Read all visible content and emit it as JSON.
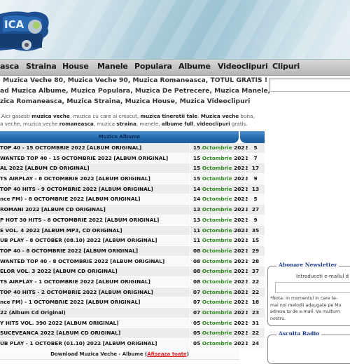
{
  "header": {
    "logo_alt": "Muzica Veche logo",
    "logo_text": "ICA"
  },
  "nav": {
    "items": [
      {
        "label": "asca"
      },
      {
        "label": "Straina"
      },
      {
        "label": "House"
      },
      {
        "label": "Manele"
      },
      {
        "label": "Populara"
      },
      {
        "label": "Albume"
      },
      {
        "label": "Videoclipuri"
      },
      {
        "label": "Clipuri"
      }
    ]
  },
  "intro": {
    "line1": "Muzica Veche 80, Muzica Veche 90, Muzica Romaneasca, TOTUL GRATIS !",
    "line2": "ad Muzica Albume, Muzica Populara, Muzica De Petrecere, Muzica Manele,",
    "line3": "zica Romaneasca, Muzica Straina, Muzica House, Muzica Videoclipuri"
  },
  "description": {
    "l1_a": "Aici gasesti ",
    "l1_b": "muzica veche",
    "l1_c": ", muzica cu care ai crescut, ",
    "l1_d": "muzica tineretii tale",
    "l1_e": ". ",
    "l1_f": "Muzica veche",
    "l1_g": " buna,",
    "l2_a": "a veche, muzica veche ",
    "l2_b": "romaneasca",
    "l2_c": ", muzica ",
    "l2_d": "straina",
    "l2_e": ", manele, ",
    "l2_f": "albume full",
    "l2_g": ", ",
    "l2_h": "videoclipuri",
    "l2_i": " gratis."
  },
  "albums_table": {
    "header": "Muzica Albume",
    "rows": [
      {
        "title": "TOP 40 - 15 OCTOMBRIE 2022 [ALBUM ORIGINAL]",
        "day": "15",
        "month": "Octombrie",
        "year": "2022",
        "count": "5"
      },
      {
        "title": "WANTED TOP 40 - 15 OCTOMBRIE 2022 [ALBUM ORIGINAL]",
        "day": "15",
        "month": "Octombrie",
        "year": "2022",
        "count": "7"
      },
      {
        "title": "AL 2022 [ALBUM CD ORIGINAL]",
        "day": "15",
        "month": "Octombrie",
        "year": "2022",
        "count": "17"
      },
      {
        "title": "TS AIRPLAY - 8 OCTOMBRIE 2022 [ALBUM ORIGINAL]",
        "day": "15",
        "month": "Octombrie",
        "year": "2022",
        "count": "9"
      },
      {
        "title": "TOP 40 HITS - 9 OCTOMBRIE 2022 [ALBUM ORIGINAL]",
        "day": "14",
        "month": "Octombrie",
        "year": "2022",
        "count": "13"
      },
      {
        "title": "nce FM) - 8 OCTOMBRIE 2022 [ALBUM ORIGINAL]",
        "day": "14",
        "month": "Octombrie",
        "year": "2022",
        "count": "5"
      },
      {
        "title": "ROMANI 2022 [ALBUM CD ORIGINAL]",
        "day": "13",
        "month": "Octombrie",
        "year": "2022",
        "count": "27"
      },
      {
        "title": "P HOT 30 HITS - 8 OCTOMBRIE 2022 [ALBUM ORIGINAL]",
        "day": "13",
        "month": "Octombrie",
        "year": "2022",
        "count": "9"
      },
      {
        "title": "E VOL. 4 2022 [ALBUM MP3, CD ORIGINAL]",
        "day": "11",
        "month": "Octombrie",
        "year": "2022",
        "count": "35"
      },
      {
        "title": "UB PLAY - 8 OCTOBER (08.10) 2022 [ALBUM ORIGINAL]",
        "day": "11",
        "month": "Octombrie",
        "year": "2022",
        "count": "15"
      },
      {
        "title": "TOP 40 - 8 OCTOMBRIE 2022 [ALBUM ORIGINAL]",
        "day": "08",
        "month": "Octombrie",
        "year": "2022",
        "count": "29"
      },
      {
        "title": "WANTED TOP 40 - 8 OCTOMBRIE 2022 [ALBUM ORIGINAL]",
        "day": "08",
        "month": "Octombrie",
        "year": "2022",
        "count": "28"
      },
      {
        "title": "ELOR VOL. 3 2022 [ALBUM CD ORIGINAL]",
        "day": "08",
        "month": "Octombrie",
        "year": "2022",
        "count": "37"
      },
      {
        "title": "TS AIRPLAY - 1 OCTOMBRIE 2022 [ALBUM ORIGINAL]",
        "day": "08",
        "month": "Octombrie",
        "year": "2022",
        "count": "22"
      },
      {
        "title": "TOP 40 HITS - 2 OCTOMBRIE 2022 [ALBUM ORIGINAL]",
        "day": "07",
        "month": "Octombrie",
        "year": "2022",
        "count": "22"
      },
      {
        "title": "nce FM) - 1 OCTOMBRIE 2022 [ALBUM ORIGINAL]",
        "day": "07",
        "month": "Octombrie",
        "year": "2022",
        "count": "18"
      },
      {
        "title": "22 (Album Cd Original)",
        "day": "07",
        "month": "Octombrie",
        "year": "2022",
        "count": "23"
      },
      {
        "title": "Y HITS VOL. 390 2022 [ALBUM ORIGINAL]",
        "day": "05",
        "month": "Octombrie",
        "year": "2022",
        "count": "31"
      },
      {
        "title": "SUCEVEANCA 2022 [ALBUM CD ORIGINAL]",
        "day": "05",
        "month": "Octombrie",
        "year": "2022",
        "count": "22"
      },
      {
        "title": "UB PLAY - 1 OCTOBER (01.10) 2022 [ALBUM ORIGINAL]",
        "day": "05",
        "month": "Octombrie",
        "year": "2022",
        "count": "24"
      }
    ],
    "footer_text": "Download Muzica Veche - Albume (",
    "footer_link": "Afiseaza toate",
    "footer_close": ")"
  },
  "sidebar": {
    "search_value": "",
    "newsletter": {
      "legend": "Abonare Newsletter",
      "label": "Introduceti e-mailul d",
      "email_value": "",
      "note_1": "*Nota: In momentul in care te-",
      "note_2": "mai noi melodii adaugate pe Mu",
      "note_3": "adresa ta de e-mail. Va multum",
      "note_4": "nostru."
    },
    "radio": {
      "legend": "Asculta Radio"
    }
  },
  "colors": {
    "table_header": "#2169ad",
    "month_green": "#2e8b1f",
    "link_red": "#e41b1b",
    "legend_blue": "#1b3a8c"
  }
}
